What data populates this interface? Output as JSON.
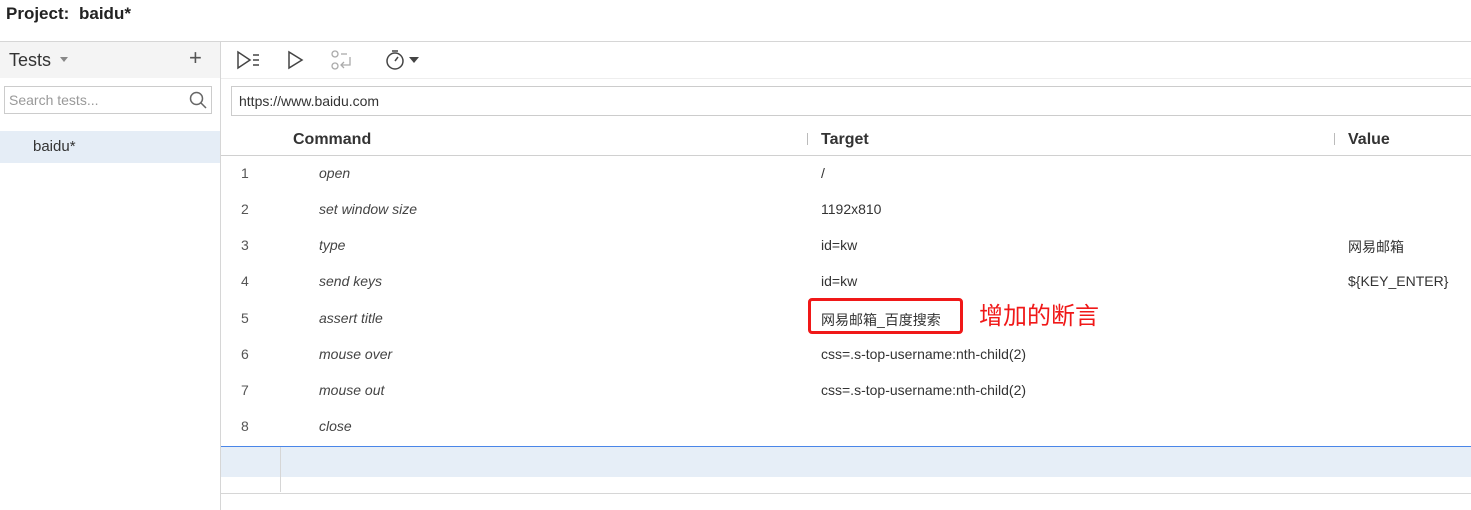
{
  "project": {
    "label": "Project:",
    "name": "baidu*"
  },
  "sidebar": {
    "title": "Tests",
    "add_icon": "plus-icon",
    "search": {
      "placeholder": "Search tests...",
      "value": ""
    },
    "tests": [
      {
        "label": "baidu*",
        "selected": true
      }
    ]
  },
  "toolbar": {
    "buttons": [
      "run-all-icon",
      "run-icon",
      "step-icon",
      "timer-icon"
    ]
  },
  "url": {
    "value": "https://www.baidu.com"
  },
  "table": {
    "headers": {
      "command": "Command",
      "target": "Target",
      "value": "Value"
    },
    "rows": [
      {
        "num": "1",
        "command": "open",
        "target": "/",
        "value": ""
      },
      {
        "num": "2",
        "command": "set window size",
        "target": "1192x810",
        "value": ""
      },
      {
        "num": "3",
        "command": "type",
        "target": "id=kw",
        "value": "网易邮箱"
      },
      {
        "num": "4",
        "command": "send keys",
        "target": "id=kw",
        "value": "${KEY_ENTER}"
      },
      {
        "num": "5",
        "command": "assert title",
        "target": "网易邮箱_百度搜索",
        "value": ""
      },
      {
        "num": "6",
        "command": "mouse over",
        "target": "css=.s-top-username:nth-child(2)",
        "value": ""
      },
      {
        "num": "7",
        "command": "mouse out",
        "target": "css=.s-top-username:nth-child(2)",
        "value": ""
      },
      {
        "num": "8",
        "command": "close",
        "target": "",
        "value": ""
      }
    ]
  },
  "annotation": {
    "text": "增加的断言",
    "color": "#f01818"
  },
  "colors": {
    "accent": "#4a86e8",
    "selected_bg": "#e5edf6",
    "annotation_red": "#f01818"
  }
}
